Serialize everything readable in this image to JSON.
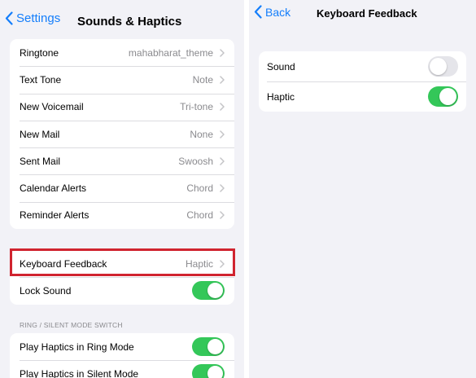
{
  "left": {
    "nav": {
      "back_label": "Settings",
      "title": "Sounds & Haptics"
    },
    "alerts": [
      {
        "label": "Ringtone",
        "value": "mahabharat_theme"
      },
      {
        "label": "Text Tone",
        "value": "Note"
      },
      {
        "label": "New Voicemail",
        "value": "Tri-tone"
      },
      {
        "label": "New Mail",
        "value": "None"
      },
      {
        "label": "Sent Mail",
        "value": "Swoosh"
      },
      {
        "label": "Calendar Alerts",
        "value": "Chord"
      },
      {
        "label": "Reminder Alerts",
        "value": "Chord"
      }
    ],
    "keyboard_feedback": {
      "label": "Keyboard Feedback",
      "value": "Haptic"
    },
    "lock_sound": {
      "label": "Lock Sound",
      "on": true
    },
    "ring_section_header": "RING / SILENT MODE SWITCH",
    "ring_mode": {
      "label": "Play Haptics in Ring Mode",
      "on": true
    },
    "silent_mode": {
      "label": "Play Haptics in Silent Mode",
      "on": true
    }
  },
  "right": {
    "nav": {
      "back_label": "Back",
      "title": "Keyboard Feedback"
    },
    "sound": {
      "label": "Sound",
      "on": false
    },
    "haptic": {
      "label": "Haptic",
      "on": true
    }
  },
  "colors": {
    "accent": "#147efb",
    "toggle_on": "#34c759",
    "toggle_off": "#e5e5ea",
    "highlight": "#d0242f",
    "background": "#f2f2f7"
  },
  "icons": [
    "chevron-left-icon",
    "chevron-right-icon"
  ]
}
